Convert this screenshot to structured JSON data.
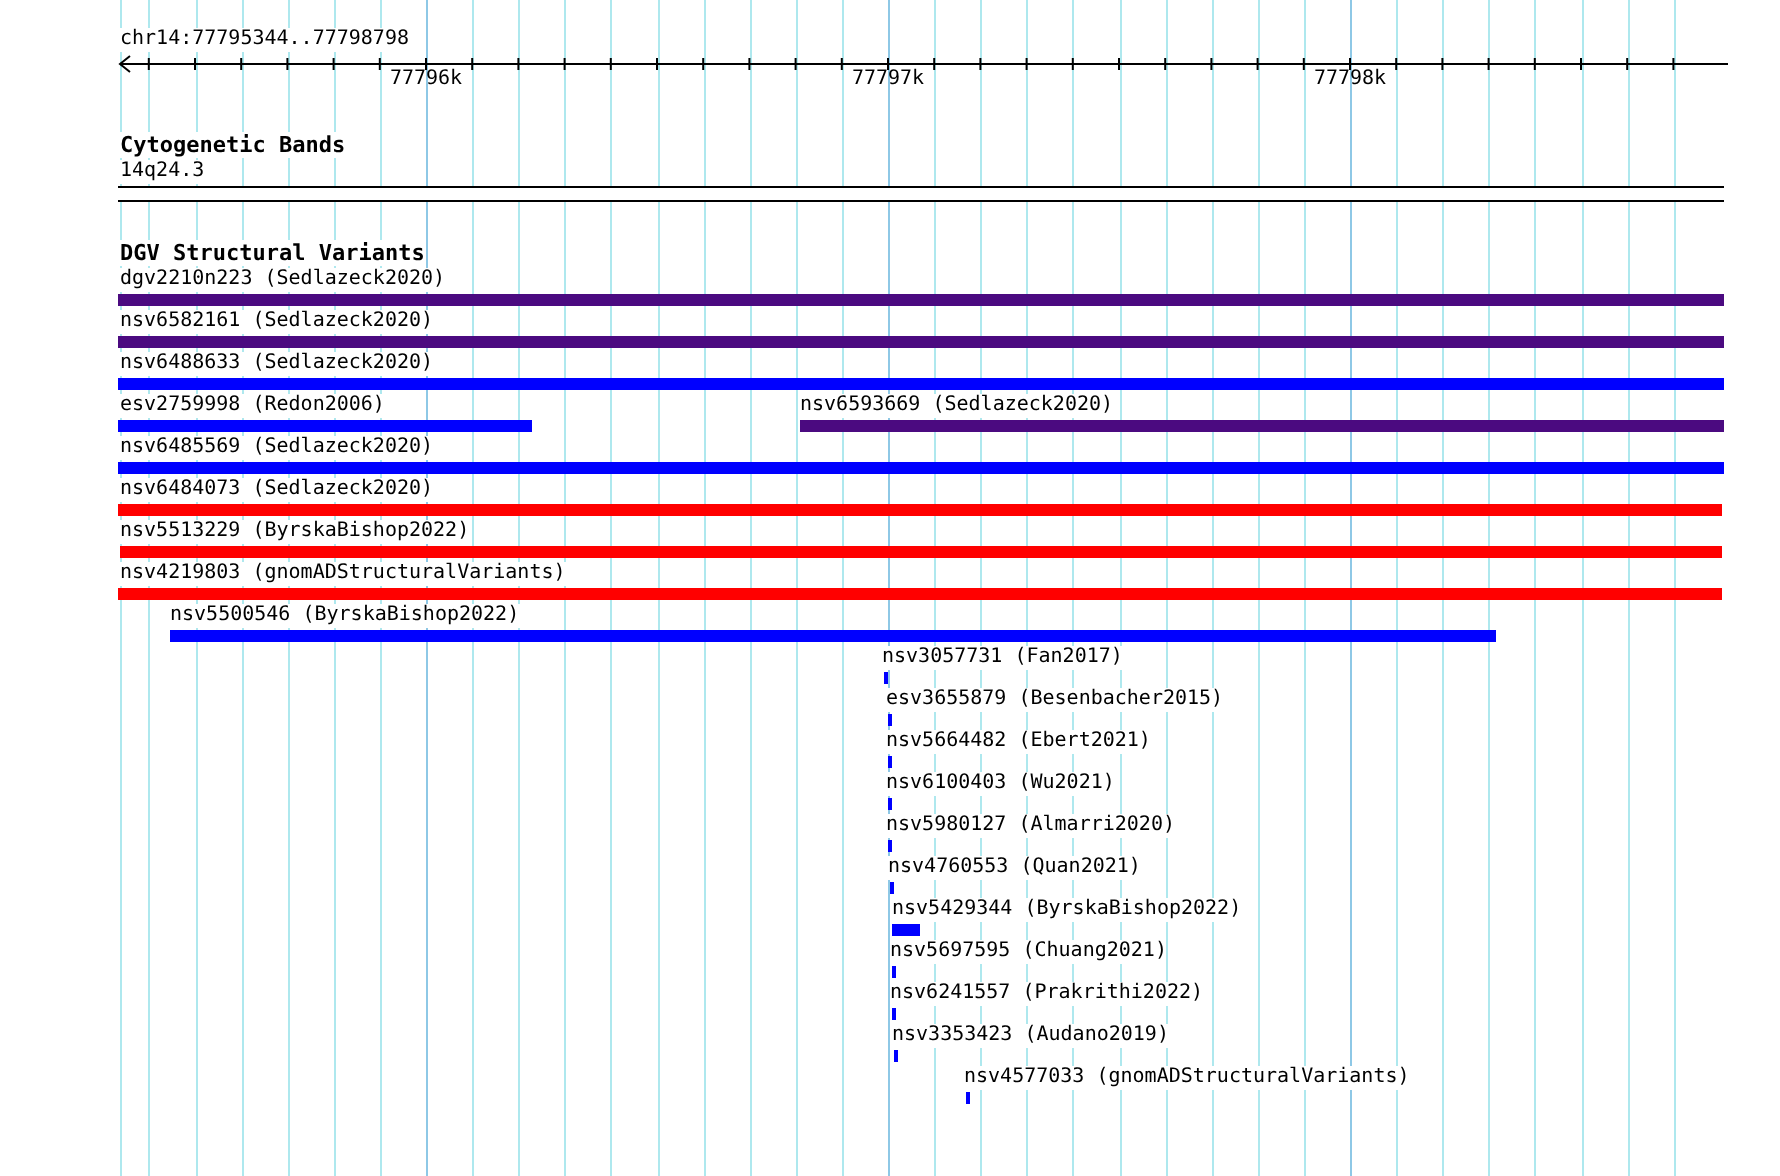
{
  "ruler": {
    "location": "chr14:77795344..77798798",
    "ticks": [
      "77796k",
      "77797k",
      "77798k"
    ]
  },
  "cyto_track": {
    "title": "Cytogenetic Bands",
    "band": "14q24.3"
  },
  "sv_track": {
    "title": "DGV Structural Variants",
    "rows": [
      {
        "features": [
          {
            "label": "dgv2210n223 (Sedlazeck2020)",
            "color": "#4b0a80"
          }
        ]
      },
      {
        "features": [
          {
            "label": "nsv6582161 (Sedlazeck2020)",
            "color": "#4b0a80"
          }
        ]
      },
      {
        "features": [
          {
            "label": "nsv6488633 (Sedlazeck2020)",
            "color": "#0000ff"
          }
        ]
      },
      {
        "features": [
          {
            "label": "esv2759998 (Redon2006)",
            "color": "#0000ff"
          },
          {
            "label": "nsv6593669 (Sedlazeck2020)",
            "color": "#4b0a80"
          }
        ]
      },
      {
        "features": [
          {
            "label": "nsv6485569 (Sedlazeck2020)",
            "color": "#0000ff"
          }
        ]
      },
      {
        "features": [
          {
            "label": "nsv6484073 (Sedlazeck2020)",
            "color": "#ff0000"
          }
        ]
      },
      {
        "features": [
          {
            "label": "nsv5513229 (ByrskaBishop2022)",
            "color": "#ff0000"
          }
        ]
      },
      {
        "features": [
          {
            "label": "nsv4219803 (gnomADStructuralVariants)",
            "color": "#ff0000"
          }
        ]
      },
      {
        "features": [
          {
            "label": "nsv5500546 (ByrskaBishop2022)",
            "color": "#0000ff"
          }
        ]
      },
      {
        "features": [
          {
            "label": "nsv3057731 (Fan2017)",
            "color": "#0000ff"
          }
        ]
      },
      {
        "features": [
          {
            "label": "esv3655879 (Besenbacher2015)",
            "color": "#0000ff"
          }
        ]
      },
      {
        "features": [
          {
            "label": "nsv5664482 (Ebert2021)",
            "color": "#0000ff"
          }
        ]
      },
      {
        "features": [
          {
            "label": "nsv6100403 (Wu2021)",
            "color": "#0000ff"
          }
        ]
      },
      {
        "features": [
          {
            "label": "nsv5980127 (Almarri2020)",
            "color": "#0000ff"
          }
        ]
      },
      {
        "features": [
          {
            "label": "nsv4760553 (Quan2021)",
            "color": "#0000ff"
          }
        ]
      },
      {
        "features": [
          {
            "label": "nsv5429344 (ByrskaBishop2022)",
            "color": "#0000ff"
          }
        ]
      },
      {
        "features": [
          {
            "label": "nsv5697595 (Chuang2021)",
            "color": "#0000ff"
          }
        ]
      },
      {
        "features": [
          {
            "label": "nsv6241557 (Prakrithi2022)",
            "color": "#0000ff"
          }
        ]
      },
      {
        "features": [
          {
            "label": "nsv3353423 (Audano2019)",
            "color": "#0000ff"
          }
        ]
      },
      {
        "features": [
          {
            "label": "nsv4577033 (gnomADStructuralVariants)",
            "color": "#0000ff"
          }
        ]
      }
    ]
  }
}
